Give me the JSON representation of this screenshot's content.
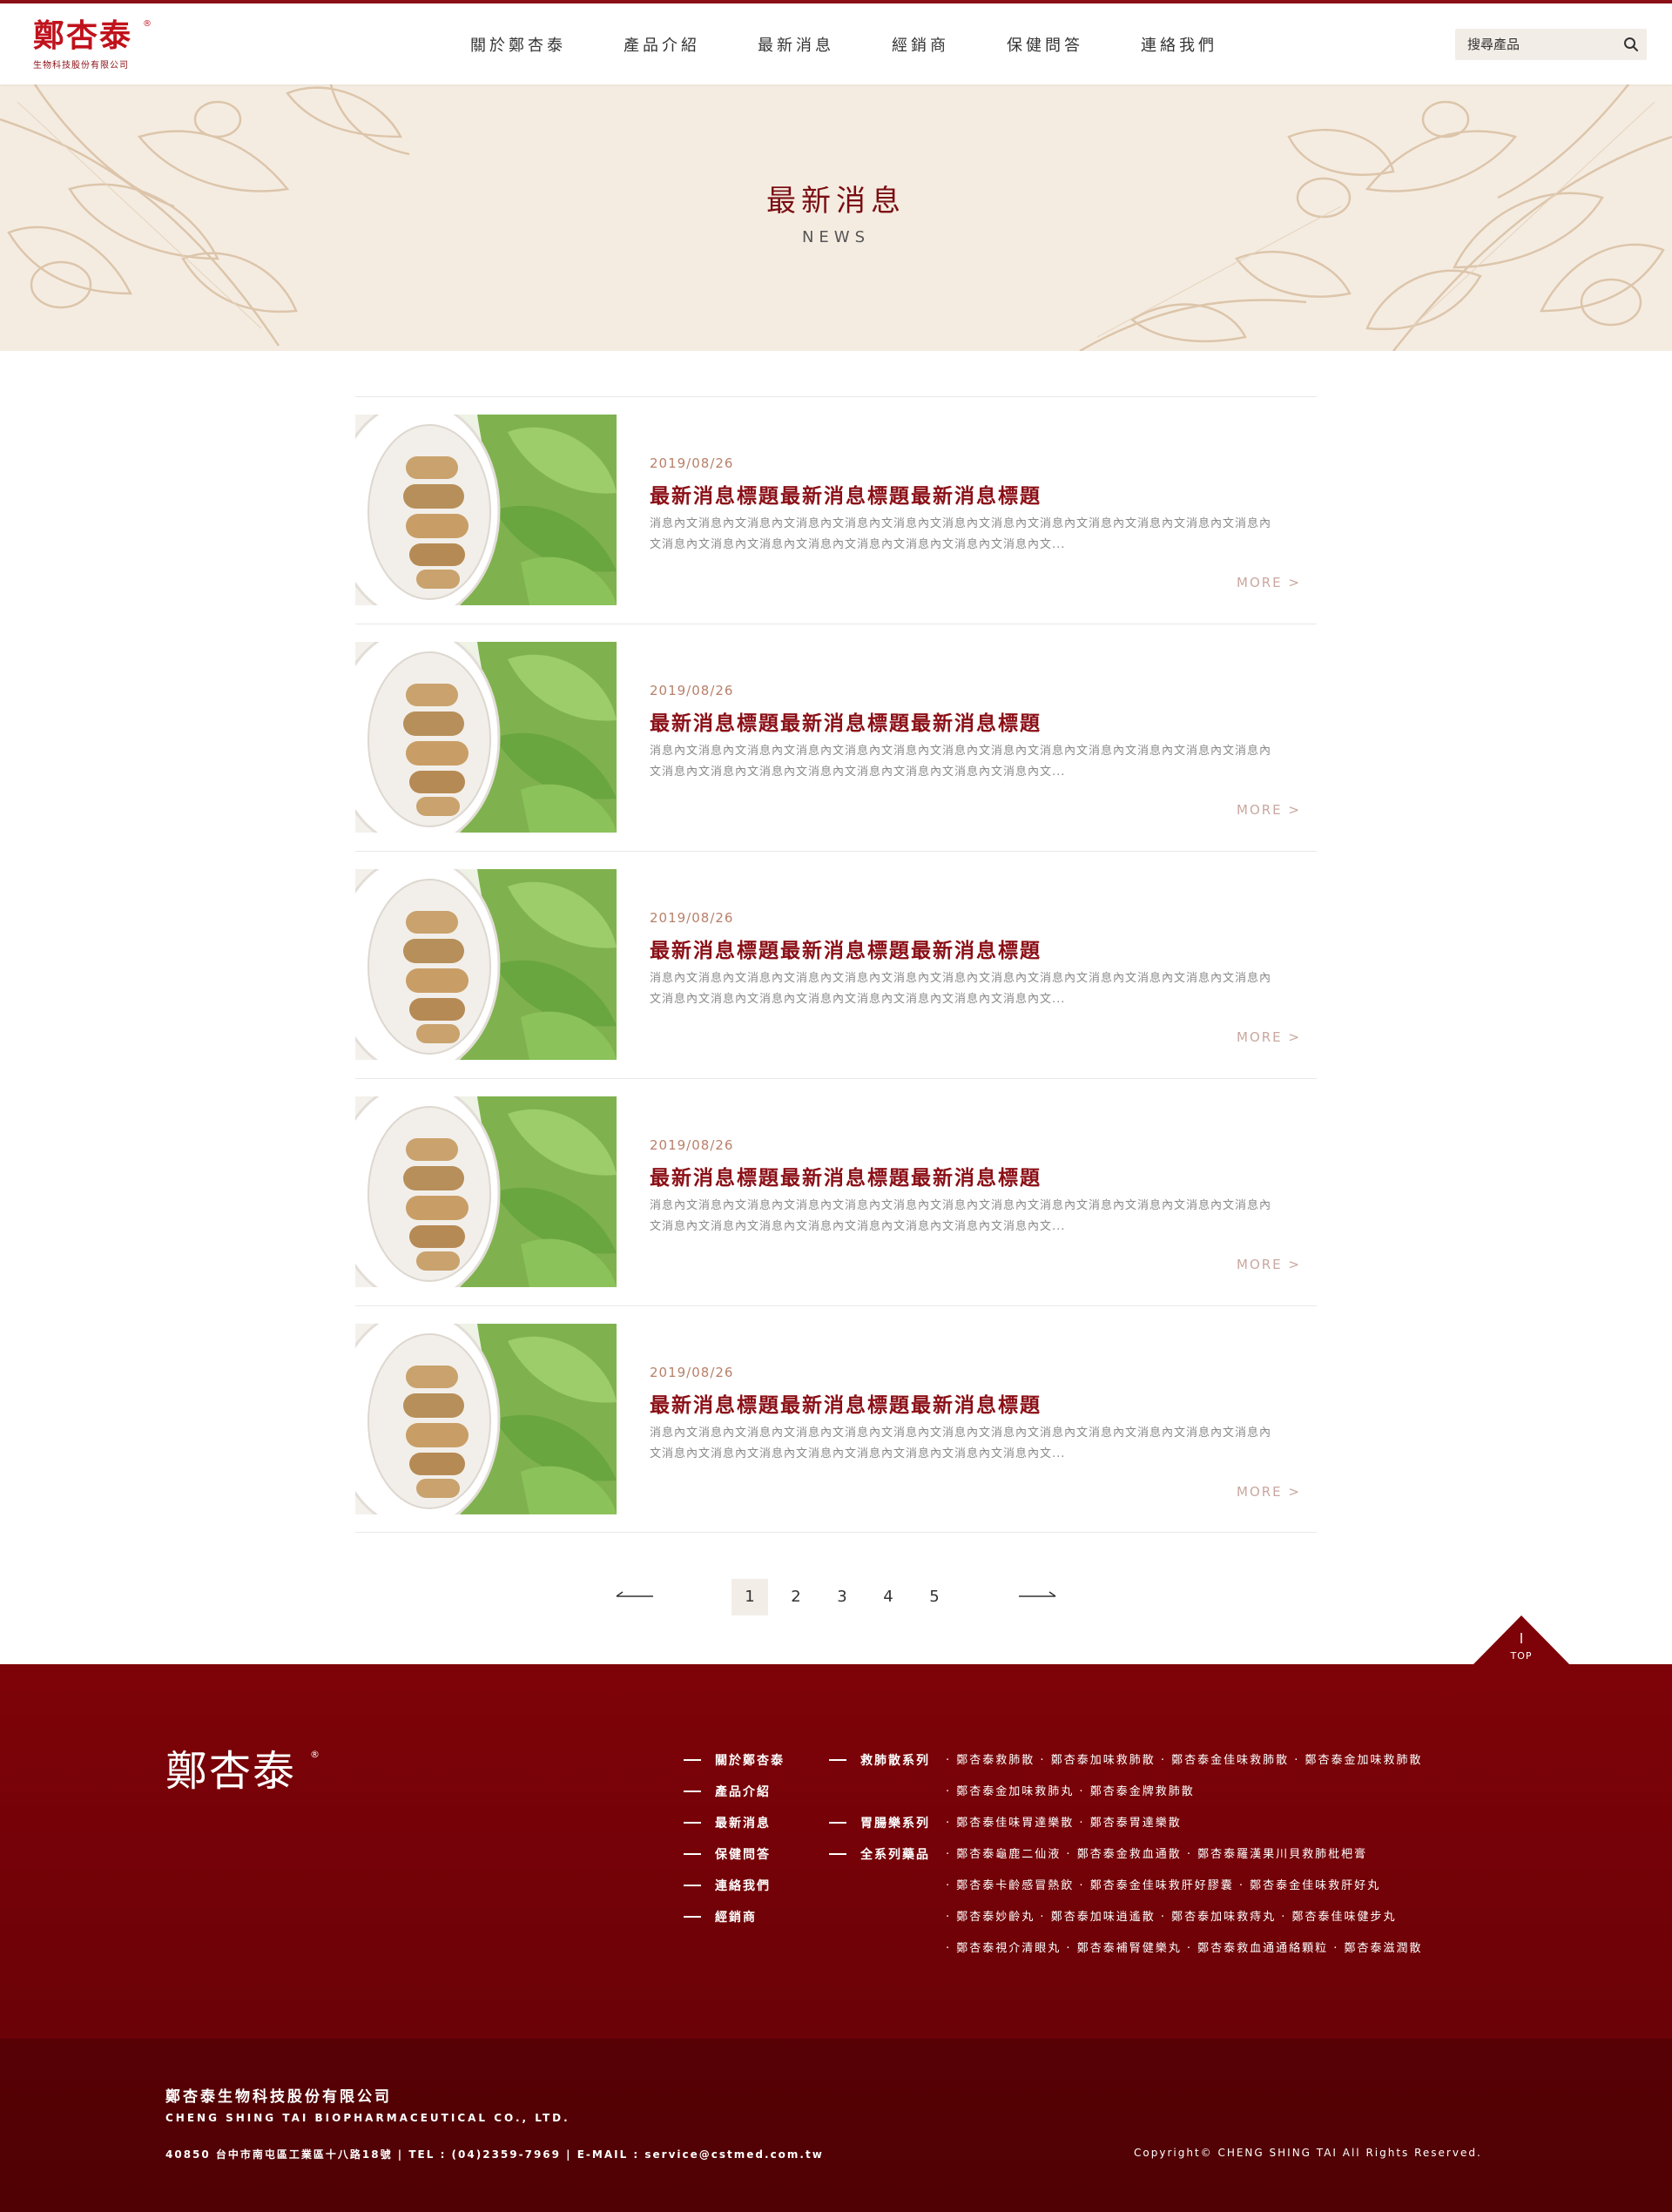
{
  "header": {
    "logo_text": "鄭杏泰",
    "logo_reg": "®",
    "logo_sub": "生物科技股份有限公司",
    "nav": [
      "關於鄭杏泰",
      "產品介紹",
      "最新消息",
      "經銷商",
      "保健問答",
      "連絡我們"
    ],
    "search_placeholder": "搜尋產品",
    "search_icon": "search-icon"
  },
  "banner": {
    "title": "最新消息",
    "subtitle": "NEWS"
  },
  "news": [
    {
      "date": "2019/08/26",
      "title": "最新消息標題最新消息標題最新消息標題",
      "text": "消息內文消息內文消息內文消息內文消息內文消息內文消息內文消息內文消息內文消息內文消息內文消息內文消息內文消息內文消息內文消息內文消息內文消息內文消息內文消息內文消息內文...",
      "more": "MORE >"
    },
    {
      "date": "2019/08/26",
      "title": "最新消息標題最新消息標題最新消息標題",
      "text": "消息內文消息內文消息內文消息內文消息內文消息內文消息內文消息內文消息內文消息內文消息內文消息內文消息內文消息內文消息內文消息內文消息內文消息內文消息內文消息內文消息內文...",
      "more": "MORE >"
    },
    {
      "date": "2019/08/26",
      "title": "最新消息標題最新消息標題最新消息標題",
      "text": "消息內文消息內文消息內文消息內文消息內文消息內文消息內文消息內文消息內文消息內文消息內文消息內文消息內文消息內文消息內文消息內文消息內文消息內文消息內文消息內文消息內文...",
      "more": "MORE >"
    },
    {
      "date": "2019/08/26",
      "title": "最新消息標題最新消息標題最新消息標題",
      "text": "消息內文消息內文消息內文消息內文消息內文消息內文消息內文消息內文消息內文消息內文消息內文消息內文消息內文消息內文消息內文消息內文消息內文消息內文消息內文消息內文消息內文...",
      "more": "MORE >"
    },
    {
      "date": "2019/08/26",
      "title": "最新消息標題最新消息標題最新消息標題",
      "text": "消息內文消息內文消息內文消息內文消息內文消息內文消息內文消息內文消息內文消息內文消息內文消息內文消息內文消息內文消息內文消息內文消息內文消息內文消息內文消息內文消息內文...",
      "more": "MORE >"
    }
  ],
  "pagination": {
    "pages": [
      "1",
      "2",
      "3",
      "4",
      "5"
    ],
    "current": "1"
  },
  "to_top": "TOP",
  "footer": {
    "logo_text": "鄭杏泰",
    "logo_reg": "®",
    "nav": [
      "關於鄭杏泰",
      "產品介紹",
      "最新消息",
      "保健問答",
      "連絡我們",
      "經銷商"
    ],
    "series": [
      "救肺散系列",
      "胃腸樂系列",
      "全系列藥品"
    ],
    "products": [
      [
        "鄭杏泰救肺散",
        "鄭杏泰加味救肺散",
        "鄭杏泰金佳味救肺散",
        "鄭杏泰金加味救肺散"
      ],
      [
        "鄭杏泰金加味救肺丸",
        "鄭杏泰金牌救肺散"
      ],
      [
        "鄭杏泰佳味胃達樂散",
        "鄭杏泰胃達樂散"
      ],
      [
        "鄭杏泰龜鹿二仙液",
        "鄭杏泰金救血通散",
        "鄭杏泰羅漢果川貝救肺枇杷膏"
      ],
      [
        "鄭杏泰卡齡感冒熱飲",
        "鄭杏泰金佳味救肝好膠囊",
        "鄭杏泰金佳味救肝好丸"
      ],
      [
        "鄭杏泰妙齡丸",
        "鄭杏泰加味逍遙散",
        "鄭杏泰加味救痔丸",
        "鄭杏泰佳味健步丸"
      ],
      [
        "鄭杏泰視介清眼丸",
        "鄭杏泰補腎健樂丸",
        "鄭杏泰救血通通絡顆粒",
        "鄭杏泰滋潤散"
      ]
    ],
    "company_cn": "鄭杏泰生物科技股份有限公司",
    "company_en": "CHENG SHING TAI BIOPHARMACEUTICAL CO., LTD.",
    "contact": "40850 台中市南屯區工業區十八路18號 | TEL : (04)2359-7969 | E-MAIL : service@cstmed.com.tw",
    "copyright": "Copyright© CHENG SHING TAI All Rights Reserved."
  },
  "colors": {
    "brand_red": "#8b0f16",
    "logo_red": "#c0121c",
    "banner_bg": "#f5ece1",
    "date_color": "#b8806a",
    "footer_bg": "#7e0308"
  }
}
